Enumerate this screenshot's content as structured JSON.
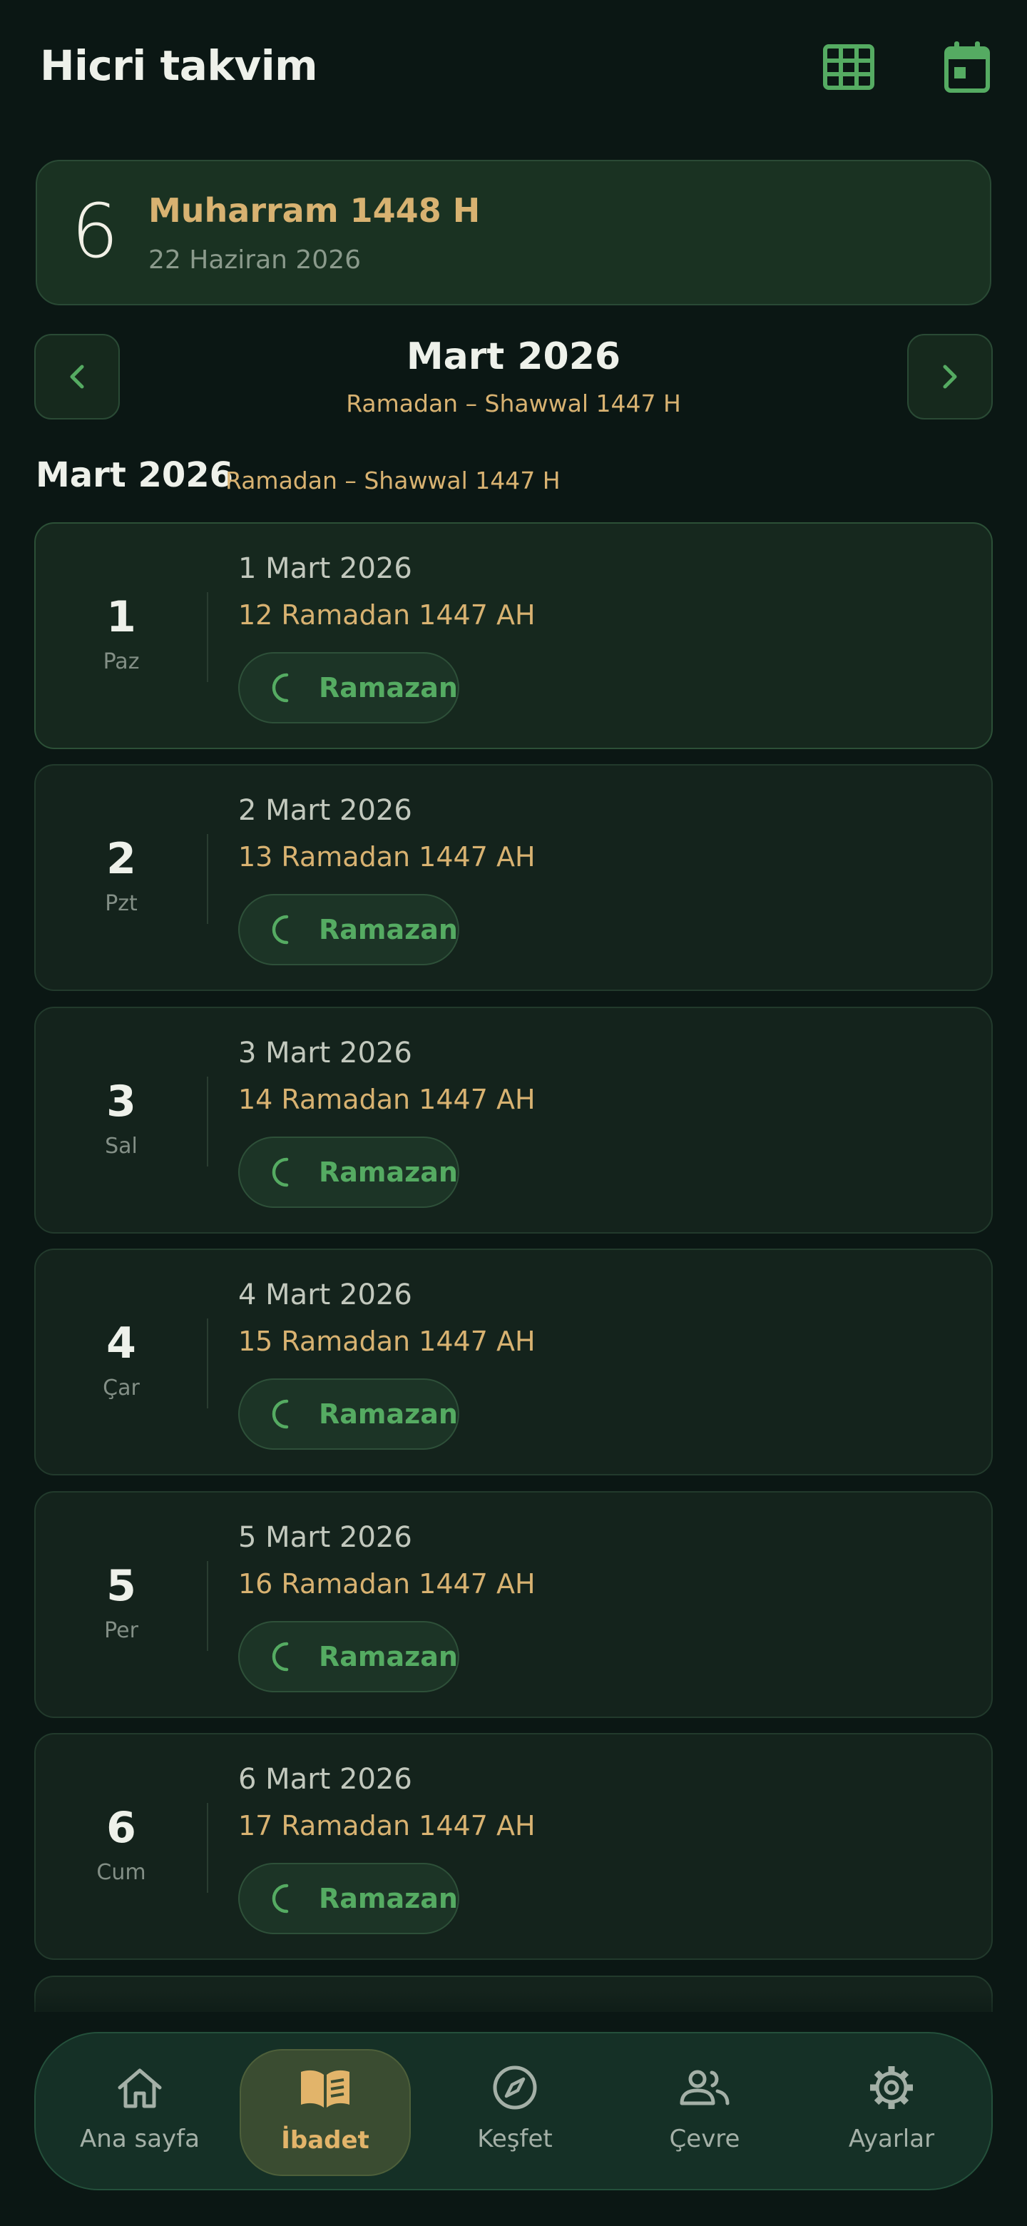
{
  "header": {
    "title": "Hicri takvim",
    "grid_icon": "grid-icon",
    "calendar_icon": "calendar-icon"
  },
  "today": {
    "day": "6",
    "hijri": "Muharram 1448 H",
    "gregorian": "22 Haziran 2026"
  },
  "month_nav": {
    "prev_icon": "chevron-left-icon",
    "next_icon": "chevron-right-icon",
    "month": "Mart 2026",
    "hijri_range": "Ramadan – Shawwal 1447 H"
  },
  "section": {
    "title": "Mart 2026",
    "hijri_range": "Ramadan – Shawwal 1447 H"
  },
  "days": [
    {
      "num": "1",
      "weekday": "Paz",
      "gregorian": "1 Mart 2026",
      "hijri": "12 Ramadan 1447 AH",
      "tag": "Ramazan"
    },
    {
      "num": "2",
      "weekday": "Pzt",
      "gregorian": "2 Mart 2026",
      "hijri": "13 Ramadan 1447 AH",
      "tag": "Ramazan"
    },
    {
      "num": "3",
      "weekday": "Sal",
      "gregorian": "3 Mart 2026",
      "hijri": "14 Ramadan 1447 AH",
      "tag": "Ramazan"
    },
    {
      "num": "4",
      "weekday": "Çar",
      "gregorian": "4 Mart 2026",
      "hijri": "15 Ramadan 1447 AH",
      "tag": "Ramazan"
    },
    {
      "num": "5",
      "weekday": "Per",
      "gregorian": "5 Mart 2026",
      "hijri": "16 Ramadan 1447 AH",
      "tag": "Ramazan"
    },
    {
      "num": "6",
      "weekday": "Cum",
      "gregorian": "6 Mart 2026",
      "hijri": "17 Ramadan 1447 AH",
      "tag": "Ramazan"
    }
  ],
  "bottom_nav": [
    {
      "label": "Ana sayfa",
      "icon": "home-icon"
    },
    {
      "label": "İbadet",
      "icon": "book-icon",
      "active": true
    },
    {
      "label": "Keşfet",
      "icon": "compass-icon"
    },
    {
      "label": "Çevre",
      "icon": "people-icon"
    },
    {
      "label": "Ayarlar",
      "icon": "gear-icon"
    }
  ],
  "colors": {
    "background": "#0b1714",
    "accent_green": "#55ab62",
    "accent_gold": "#d8b271",
    "card": "#14231c"
  }
}
